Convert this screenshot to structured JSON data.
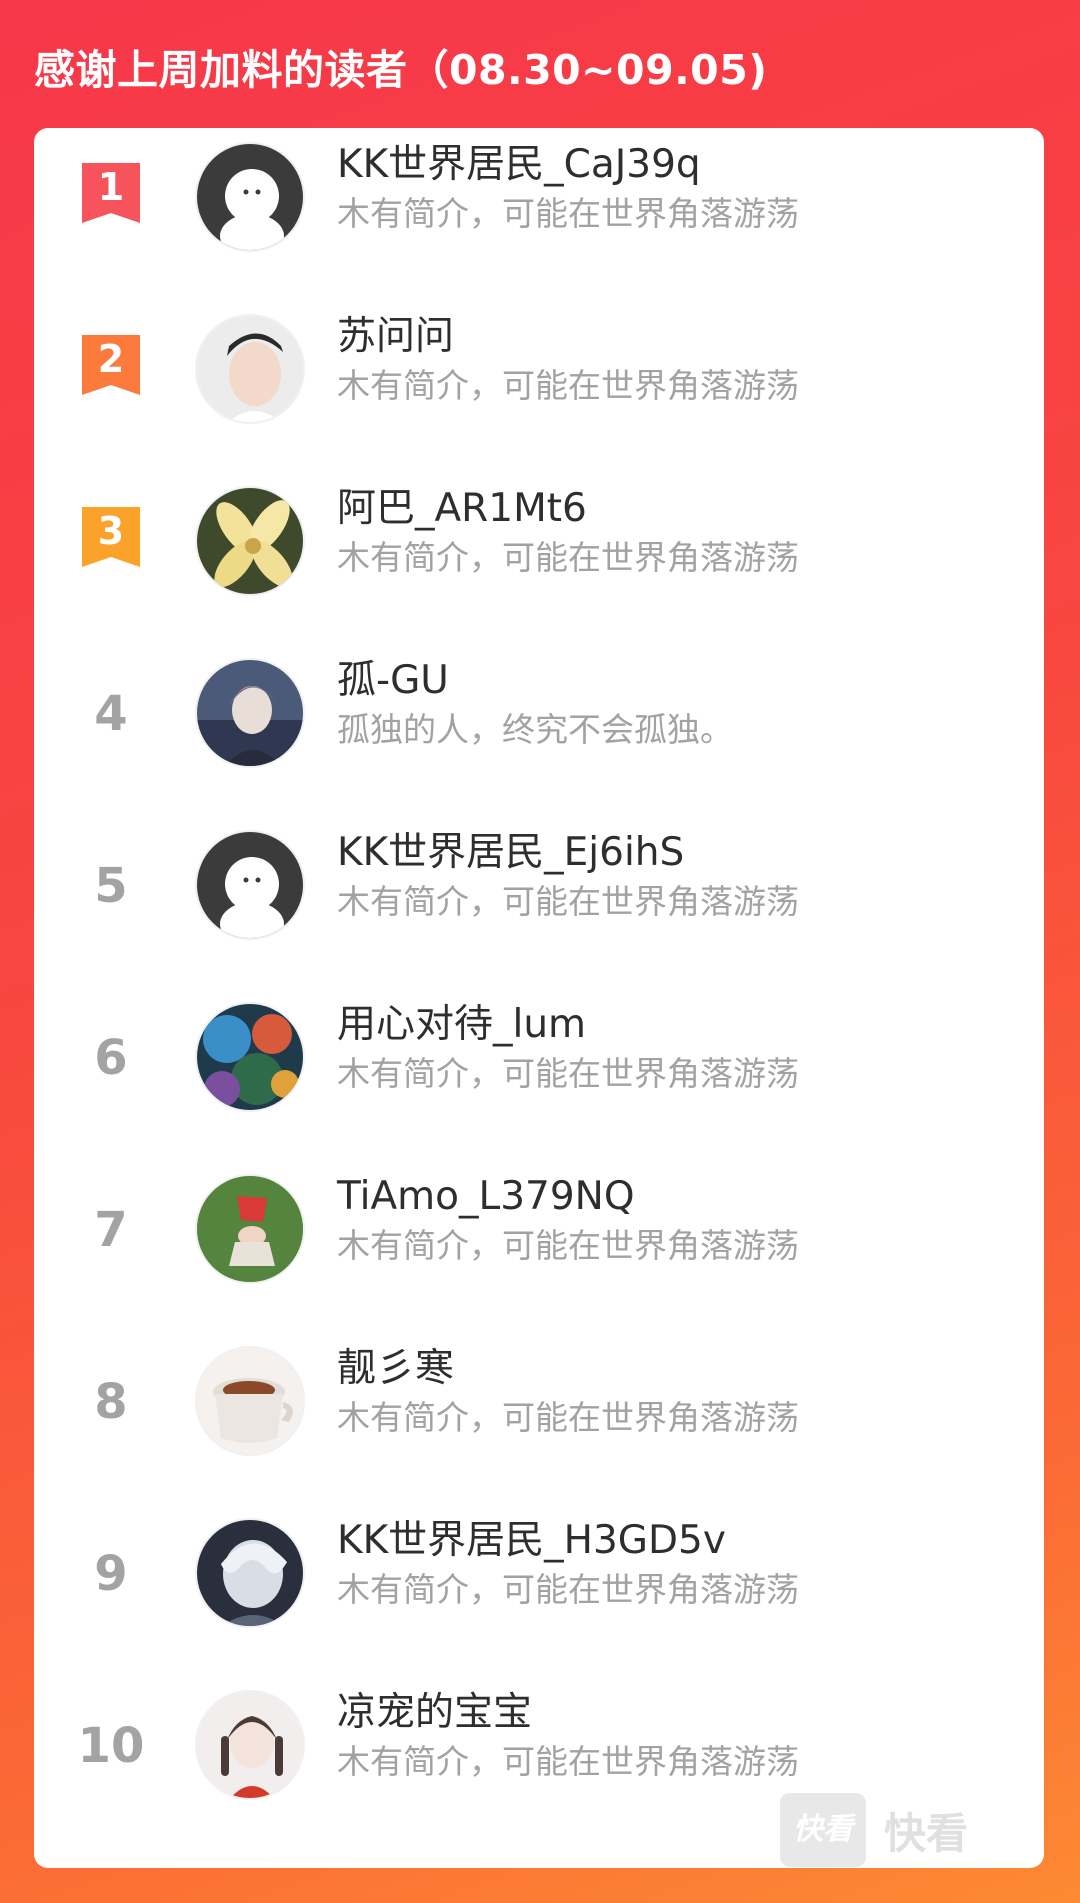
{
  "header": {
    "title": "感谢上周加料的读者（08.30~09.05)"
  },
  "readers": [
    {
      "rank": "1",
      "name": "KK世界居民_CaJ39q",
      "bio": "木有简介，可能在世界角落游荡",
      "avatar": "default-avatar",
      "badge_color": "#f7535d"
    },
    {
      "rank": "2",
      "name": "苏问问",
      "bio": "木有简介，可能在世界角落游荡",
      "avatar": "portrait-avatar",
      "badge_color": "#fb7a3c"
    },
    {
      "rank": "3",
      "name": "阿巴_AR1Mt6",
      "bio": "木有简介，可能在世界角落游荡",
      "avatar": "flower-avatar",
      "badge_color": "#fba22b"
    },
    {
      "rank": "4",
      "name": "孤-GU",
      "bio": "孤独的人，终究不会孤独。",
      "avatar": "anime-avatar"
    },
    {
      "rank": "5",
      "name": "KK世界居民_Ej6ihS",
      "bio": "木有简介，可能在世界角落游荡",
      "avatar": "default-avatar"
    },
    {
      "rank": "6",
      "name": "用心对待_lum",
      "bio": "木有简介，可能在世界角落游荡",
      "avatar": "colorful-avatar"
    },
    {
      "rank": "7",
      "name": "TiAmo_L379NQ",
      "bio": "木有简介，可能在世界角落游荡",
      "avatar": "grass-avatar"
    },
    {
      "rank": "8",
      "name": "靓彡寒",
      "bio": "木有简介，可能在世界角落游荡",
      "avatar": "coffee-avatar"
    },
    {
      "rank": "9",
      "name": "KK世界居民_H3GD5v",
      "bio": "木有简介，可能在世界角落游荡",
      "avatar": "anime-avatar-2"
    },
    {
      "rank": "10",
      "name": "凉宠的宝宝",
      "bio": "木有简介，可能在世界角落游荡",
      "avatar": "girl-avatar"
    }
  ],
  "watermark": {
    "logo_text": "快看",
    "text": "快看"
  }
}
